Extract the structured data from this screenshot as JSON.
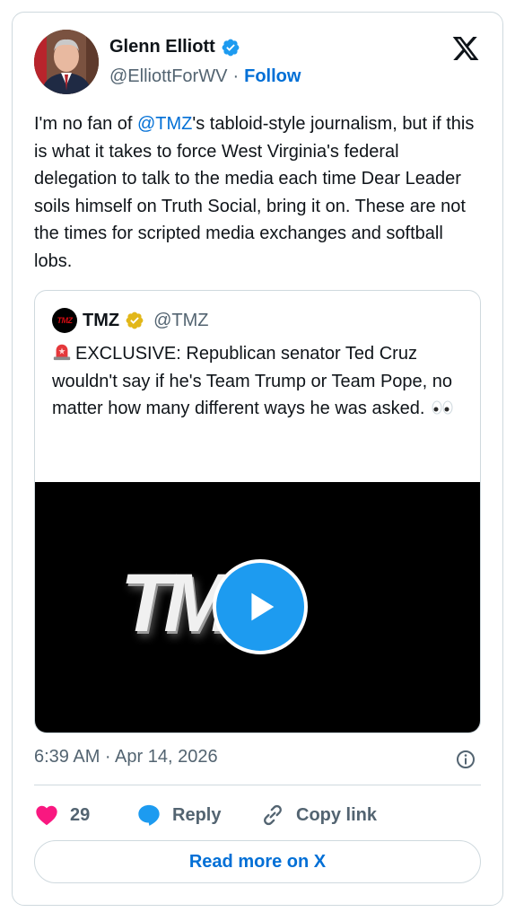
{
  "author": {
    "name": "Glenn Elliott",
    "handle": "@ElliottForWV",
    "separator": "·",
    "follow_label": "Follow"
  },
  "tweet": {
    "text_before": "I'm no fan of ",
    "mention": "@TMZ",
    "text_after": "'s tabloid-style journalism, but if this is what it takes to force West Virginia's federal delegation to talk to the media each time Dear Leader soils himself on Truth Social, bring it on. These are not the times for scripted media exchanges and softball lobs."
  },
  "quote": {
    "avatar_text": "TMZ",
    "name": "TMZ",
    "handle": "@TMZ",
    "text": "EXCLUSIVE: Republican senator Ted Cruz wouldn't say if he's Team Trump or Team Pope, no matter how many different ways he was asked.",
    "video_logo_text": "TM"
  },
  "timestamp": "6:39 AM · Apr 14, 2026",
  "actions": {
    "like_count": "29",
    "reply_label": "Reply",
    "copy_label": "Copy link"
  },
  "read_more_label": "Read more on X",
  "colors": {
    "link": "#006fd6",
    "verified_blue": "#1d9bf0",
    "verified_gold": "#e2b719",
    "heart": "#f91880",
    "secondary_text": "#536471"
  }
}
